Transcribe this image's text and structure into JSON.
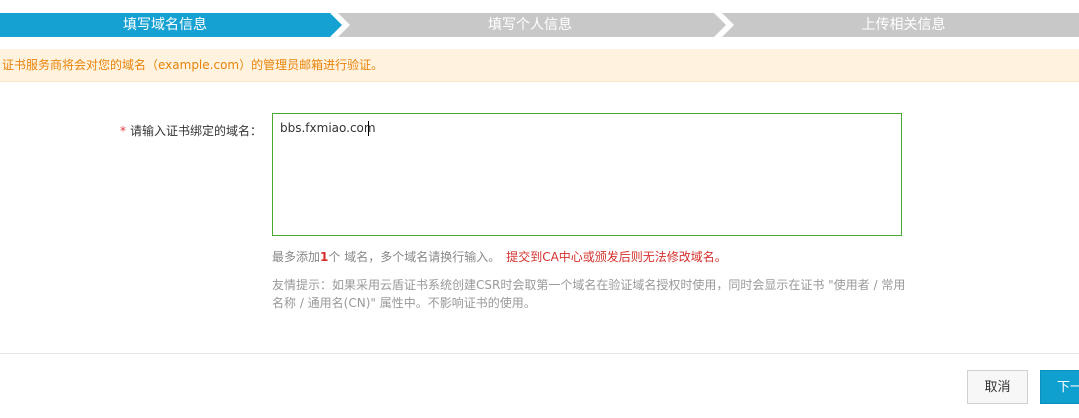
{
  "steps": [
    {
      "label": "填写域名信息",
      "active": true
    },
    {
      "label": "填写个人信息",
      "active": false
    },
    {
      "label": "上传相关信息",
      "active": false
    }
  ],
  "notice": {
    "text": "证书服务商将会对您的域名（example.com）的管理员邮箱进行验证。"
  },
  "form": {
    "required_mark": "*",
    "label": "请输入证书绑定的域名：",
    "domain_value": "bbs.fxmiao.com"
  },
  "help": {
    "prefix": "最多添加",
    "count": "1",
    "suffix": "个 域名，多个域名请换行输入。",
    "warning": "提交到CA中心或颁发后则无法修改域名。"
  },
  "tip": {
    "text": "友情提示：如果采用云盾证书系统创建CSR时会取第一个域名在验证域名授权时使用，同时会显示在证书 \"使用者 / 常用名称 / 通用名(CN)\" 属性中。不影响证书的使用。"
  },
  "buttons": {
    "cancel": "取消",
    "next": "下一步"
  },
  "colors": {
    "step_active": "#16a1d3",
    "step_inactive": "#c8c8c8",
    "notice_bg": "#fff3df",
    "notice_text": "#e8830a",
    "input_border": "#4aa832",
    "warning": "#d4302b",
    "primary_button": "#0fa0d0"
  }
}
